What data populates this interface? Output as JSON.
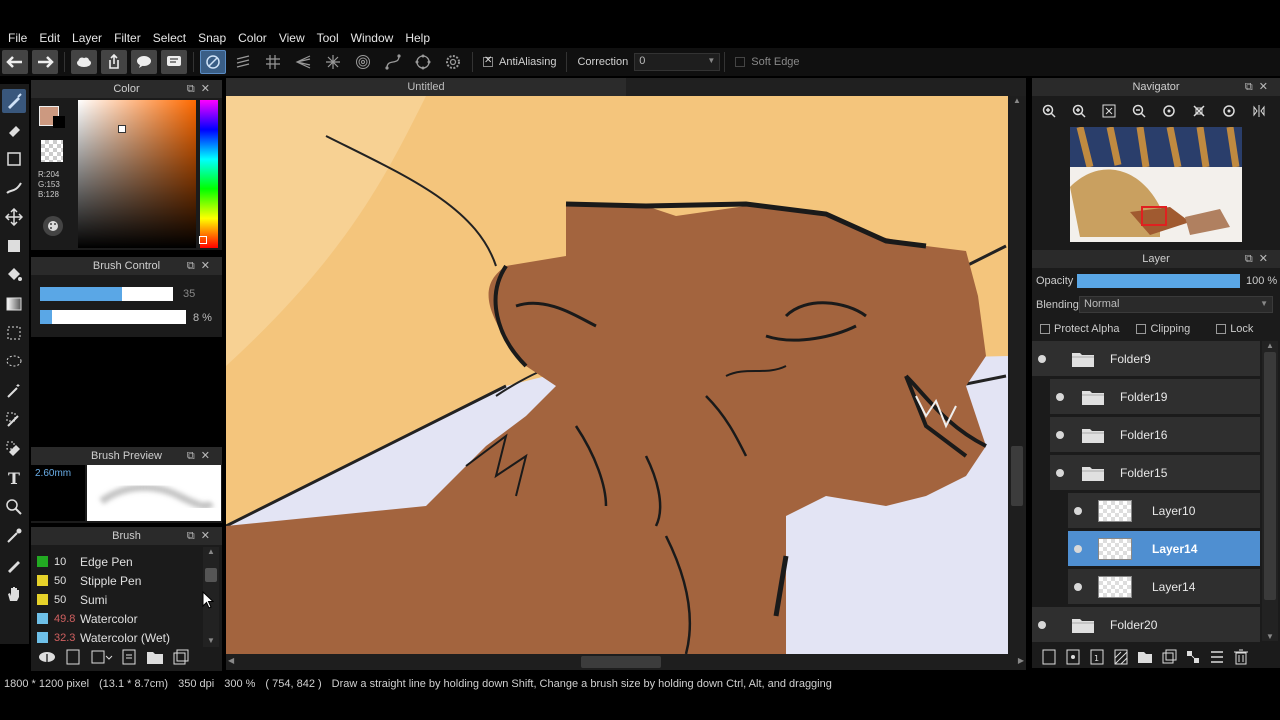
{
  "menu": [
    "File",
    "Edit",
    "Layer",
    "Filter",
    "Select",
    "Snap",
    "Color",
    "View",
    "Tool",
    "Window",
    "Help"
  ],
  "toolbar": {
    "antialiasing_label": "AntiAliasing",
    "correction_label": "Correction",
    "correction_value": "0",
    "soft_edge_label": "Soft Edge"
  },
  "color_panel": {
    "title": "Color",
    "r": "R:204",
    "g": "G:153",
    "b": "B:128",
    "foreground": "#cc9980"
  },
  "brush_control": {
    "title": "Brush Control",
    "size_value": "35",
    "size_fill": 0.62,
    "opacity_value": "8 %",
    "opacity_fill": 0.08
  },
  "brush_preview": {
    "title": "Brush Preview",
    "size": "2.60mm"
  },
  "brush_panel": {
    "title": "Brush",
    "items": [
      {
        "size": "10",
        "name": "Edge Pen",
        "color": "#22aa22",
        "size_red": false
      },
      {
        "size": "50",
        "name": "Stipple Pen",
        "color": "#e6d22a",
        "size_red": false
      },
      {
        "size": "50",
        "name": "Sumi",
        "color": "#e6d22a",
        "size_red": false
      },
      {
        "size": "49.8",
        "name": "Watercolor",
        "color": "#6ec0e8",
        "size_red": true
      },
      {
        "size": "32.3",
        "name": "Watercolor (Wet)",
        "color": "#6ec0e8",
        "size_red": true
      }
    ]
  },
  "document": {
    "tab_title": "Untitled"
  },
  "navigator": {
    "title": "Navigator"
  },
  "layer_panel": {
    "title": "Layer",
    "opacity_label": "Opacity",
    "opacity_value": "100 %",
    "opacity_fill": 1.0,
    "blending_label": "Blending",
    "blending_value": "Normal",
    "protect_alpha": "Protect Alpha",
    "clipping": "Clipping",
    "lock": "Lock",
    "layers": [
      {
        "name": "Folder9",
        "type": "folder",
        "indent": 0,
        "selected": false
      },
      {
        "name": "Folder19",
        "type": "folder",
        "indent": 1,
        "selected": false
      },
      {
        "name": "Folder16",
        "type": "folder",
        "indent": 1,
        "selected": false
      },
      {
        "name": "Folder15",
        "type": "folder",
        "indent": 1,
        "selected": false
      },
      {
        "name": "Layer10",
        "type": "layer",
        "indent": 2,
        "selected": false
      },
      {
        "name": "Layer14",
        "type": "layer",
        "indent": 2,
        "selected": true
      },
      {
        "name": "Layer14",
        "type": "layer",
        "indent": 2,
        "selected": false
      },
      {
        "name": "Folder20",
        "type": "folder",
        "indent": 0,
        "selected": false
      }
    ]
  },
  "status": {
    "pixel_size": "1800 * 1200 pixel",
    "cm_size": "(13.1 * 8.7cm)",
    "dpi": "350 dpi",
    "zoom": "300 %",
    "cursor": "( 754, 842 )",
    "hint": "Draw a straight line by holding down Shift, Change a brush size by holding down Ctrl, Alt, and dragging"
  },
  "colors": {
    "accent": "#4f8fd1",
    "sky": "#f2c27a",
    "wolf_fur": "#a3643e",
    "snow": "#e3e4f4"
  }
}
